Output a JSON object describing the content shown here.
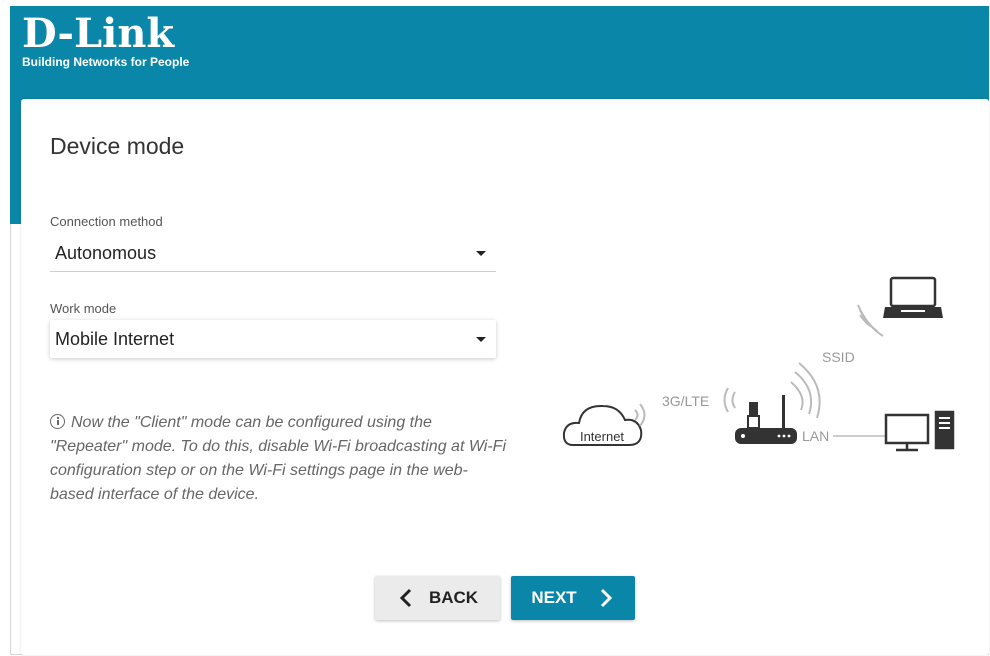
{
  "brand": {
    "name": "D-Link",
    "tagline": "Building Networks for People",
    "color": "#0a87a8"
  },
  "page": {
    "title": "Device mode"
  },
  "connection_method": {
    "label": "Connection method",
    "value": "Autonomous"
  },
  "work_mode": {
    "label": "Work mode",
    "value": "Mobile Internet"
  },
  "note": {
    "icon": "info-icon",
    "text": "Now the \"Client\" mode can be configured using the \"Repeater\" mode. To do this, disable Wi-Fi broadcasting at Wi-Fi configuration step or on the Wi-Fi settings page in the web-based interface of the device."
  },
  "diagram": {
    "internet": "Internet",
    "uplink": "3G/LTE",
    "ssid": "SSID",
    "lan": "LAN"
  },
  "buttons": {
    "back": "BACK",
    "next": "NEXT"
  }
}
